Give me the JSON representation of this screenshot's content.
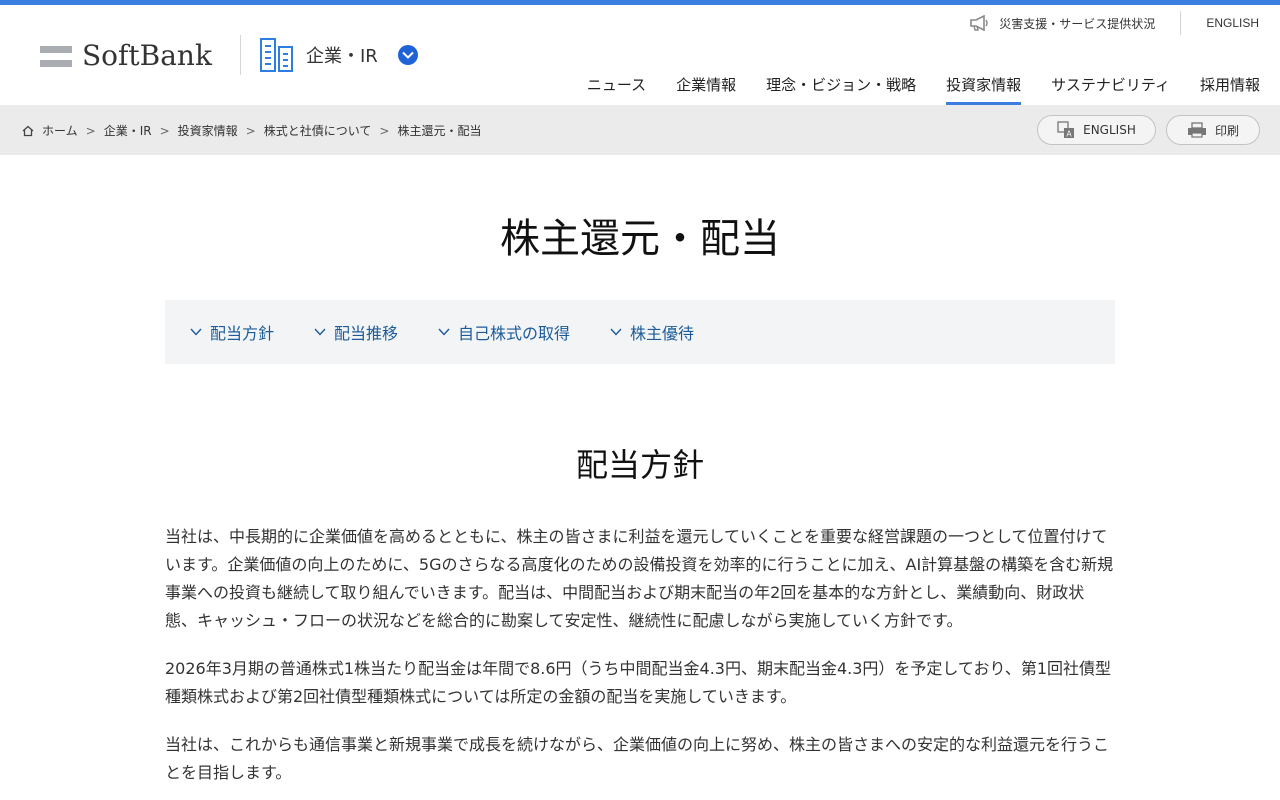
{
  "header": {
    "logo_text": "SoftBank",
    "section_label": "企業・IR",
    "utility": {
      "disaster_label": "災害支援・サービス提供状況",
      "english_label": "ENGLISH"
    },
    "nav": [
      {
        "label": "ニュース"
      },
      {
        "label": "企業情報"
      },
      {
        "label": "理念・ビジョン・戦略"
      },
      {
        "label": "投資家情報"
      },
      {
        "label": "サステナビリティ"
      },
      {
        "label": "採用情報"
      }
    ],
    "active_nav": "投資家情報",
    "accent_color": "#3a7ee0"
  },
  "breadcrumb": {
    "items": [
      "ホーム",
      "企業・IR",
      "投資家情報",
      "株式と社債について",
      "株主還元・配当"
    ],
    "separator": ">",
    "english_button": "ENGLISH",
    "print_button": "印刷"
  },
  "main": {
    "title": "株主還元・配当",
    "anchors": [
      {
        "label": "配当方針"
      },
      {
        "label": "配当推移"
      },
      {
        "label": "自己株式の取得"
      },
      {
        "label": "株主優待"
      }
    ],
    "section_title": "配当方針",
    "paragraphs": [
      "当社は、中長期的に企業価値を高めるとともに、株主の皆さまに利益を還元していくことを重要な経営課題の一つとして位置付けています。企業価値の向上のために、5Gのさらなる高度化のための設備投資を効率的に行うことに加え、AI計算基盤の構築を含む新規事業への投資も継続して取り組んでいきます。配当は、中間配当および期末配当の年2回を基本的な方針とし、業績動向、財政状態、キャッシュ・フローの状況などを総合的に勘案して安定性、継続性に配慮しながら実施していく方針です。",
      "2026年3月期の普通株式1株当たり配当金は年間で8.6円（うち中間配当金4.3円、期末配当金4.3円）を予定しており、第1回社債型種類株式および第2回社債型種類株式については所定の金額の配当を実施していきます。",
      "当社は、これからも通信事業と新規事業で成長を続けながら、企業価値の向上に努め、株主の皆さまへの安定的な利益還元を行うことを目指します。"
    ]
  }
}
